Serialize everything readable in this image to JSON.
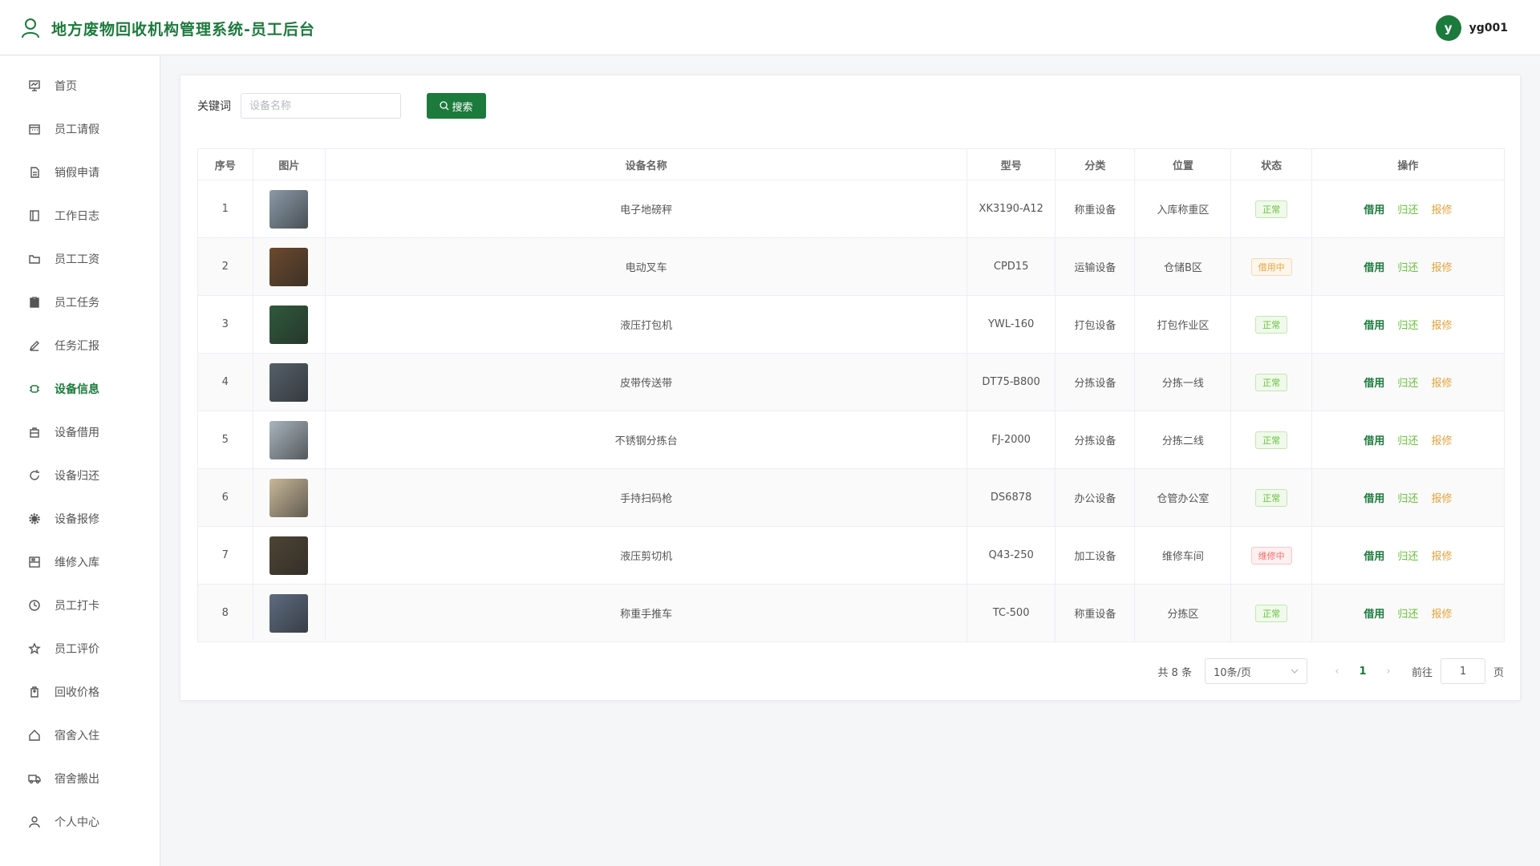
{
  "header": {
    "title": "地方废物回收机构管理系统-员工后台",
    "avatar_letter": "y",
    "username": "yg001",
    "brand_color": "#1b7a3c"
  },
  "sidebar": {
    "items": [
      {
        "label": "首页",
        "icon": "dashboard-icon"
      },
      {
        "label": "员工请假",
        "icon": "calendar-icon"
      },
      {
        "label": "销假申请",
        "icon": "document-icon"
      },
      {
        "label": "工作日志",
        "icon": "notebook-icon"
      },
      {
        "label": "员工工资",
        "icon": "folder-icon"
      },
      {
        "label": "员工任务",
        "icon": "clipboard-icon"
      },
      {
        "label": "任务汇报",
        "icon": "edit-icon"
      },
      {
        "label": "设备信息",
        "icon": "chip-icon",
        "active": true
      },
      {
        "label": "设备借用",
        "icon": "bag-icon"
      },
      {
        "label": "设备归还",
        "icon": "refresh-icon"
      },
      {
        "label": "设备报修",
        "icon": "gear-icon"
      },
      {
        "label": "维修入库",
        "icon": "box-icon"
      },
      {
        "label": "员工打卡",
        "icon": "clock-icon"
      },
      {
        "label": "员工评价",
        "icon": "star-icon"
      },
      {
        "label": "回收价格",
        "icon": "price-tag-icon"
      },
      {
        "label": "宿舍入住",
        "icon": "house-icon"
      },
      {
        "label": "宿舍搬出",
        "icon": "truck-icon"
      },
      {
        "label": "个人中心",
        "icon": "user-icon"
      }
    ]
  },
  "search": {
    "label": "关键词",
    "placeholder": "设备名称",
    "button_label": "搜索"
  },
  "table": {
    "columns": [
      "序号",
      "图片",
      "设备名称",
      "型号",
      "分类",
      "位置",
      "状态",
      "操作"
    ],
    "rows": [
      {
        "no": "1",
        "name": "电子地磅秤",
        "model": "XK3190-A12",
        "category": "称重设备",
        "location": "入库称重区",
        "status": "正常",
        "status_type": "ok",
        "thumb": "#8a9aa8"
      },
      {
        "no": "2",
        "name": "电动叉车",
        "model": "CPD15",
        "category": "运输设备",
        "location": "仓储B区",
        "status": "借用中",
        "status_type": "borrow",
        "thumb": "#6b4a2e"
      },
      {
        "no": "3",
        "name": "液压打包机",
        "model": "YWL-160",
        "category": "打包设备",
        "location": "打包作业区",
        "status": "正常",
        "status_type": "ok",
        "thumb": "#2f5a3c"
      },
      {
        "no": "4",
        "name": "皮带传送带",
        "model": "DT75-B800",
        "category": "分拣设备",
        "location": "分拣一线",
        "status": "正常",
        "status_type": "ok",
        "thumb": "#55606a"
      },
      {
        "no": "5",
        "name": "不锈钢分拣台",
        "model": "FJ-2000",
        "category": "分拣设备",
        "location": "分拣二线",
        "status": "正常",
        "status_type": "ok",
        "thumb": "#a9b4bd"
      },
      {
        "no": "6",
        "name": "手持扫码枪",
        "model": "DS6878",
        "category": "办公设备",
        "location": "仓管办公室",
        "status": "正常",
        "status_type": "ok",
        "thumb": "#c8b89a"
      },
      {
        "no": "7",
        "name": "液压剪切机",
        "model": "Q43-250",
        "category": "加工设备",
        "location": "维修车间",
        "status": "维修中",
        "status_type": "repair",
        "thumb": "#4e4434"
      },
      {
        "no": "8",
        "name": "称重手推车",
        "model": "TC-500",
        "category": "称重设备",
        "location": "分拣区",
        "status": "正常",
        "status_type": "ok",
        "thumb": "#5d6c80"
      }
    ],
    "actions": {
      "borrow": "借用",
      "return": "归还",
      "repair": "报修"
    }
  },
  "pagination": {
    "total_text": "共 8 条",
    "page_size": "10条/页",
    "current_page": "1",
    "goto_label": "前往",
    "goto_value": "1",
    "page_unit": "页"
  }
}
